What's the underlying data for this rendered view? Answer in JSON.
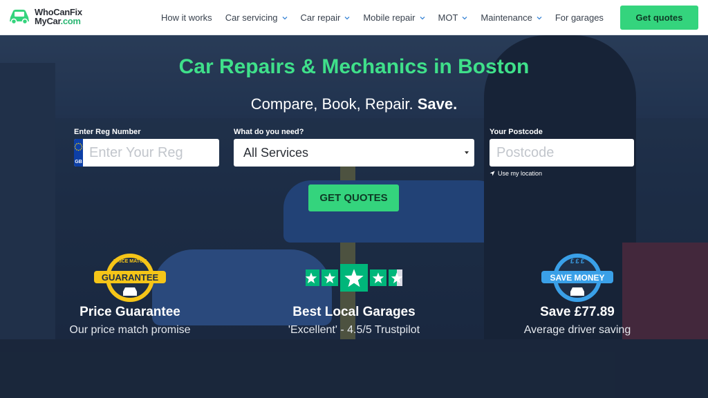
{
  "header": {
    "logo_line1": "WhoCanFix",
    "logo_line2_a": "MyCar",
    "logo_line2_b": ".com",
    "nav": [
      {
        "label": "How it works",
        "dropdown": false
      },
      {
        "label": "Car servicing",
        "dropdown": true
      },
      {
        "label": "Car repair",
        "dropdown": true
      },
      {
        "label": "Mobile repair",
        "dropdown": true
      },
      {
        "label": "MOT",
        "dropdown": true
      },
      {
        "label": "Maintenance",
        "dropdown": true
      },
      {
        "label": "For garages",
        "dropdown": false
      }
    ],
    "cta_label": "Get quotes"
  },
  "hero": {
    "title": "Car Repairs & Mechanics in Boston",
    "subtitle_main": "Compare, Book, Repair.",
    "subtitle_bold": "Save."
  },
  "form": {
    "reg_label": "Enter Reg Number",
    "reg_placeholder": "Enter Your Reg",
    "reg_country": "GB",
    "service_label": "What do you need?",
    "service_value": "All Services",
    "postcode_label": "Your Postcode",
    "postcode_placeholder": "Postcode",
    "use_location": "Use my location",
    "submit_label": "GET QUOTES"
  },
  "features": [
    {
      "badge_top": "PRICE MATCH",
      "badge_main": "GUARANTEE",
      "title": "Price Guarantee",
      "desc": "Our price match promise"
    },
    {
      "stars": 4.5,
      "title": "Best Local Garages",
      "desc": "'Excellent' - 4.5/5 Trustpilot"
    },
    {
      "badge_main": "SAVE MONEY",
      "title": "Save £77.89",
      "desc": "Average driver saving"
    }
  ],
  "colors": {
    "accent": "#34d47d",
    "title_green": "#3fe08a",
    "trustpilot_green": "#00b67a",
    "guarantee_yellow": "#f5c518",
    "save_blue": "#3aa0e8"
  }
}
